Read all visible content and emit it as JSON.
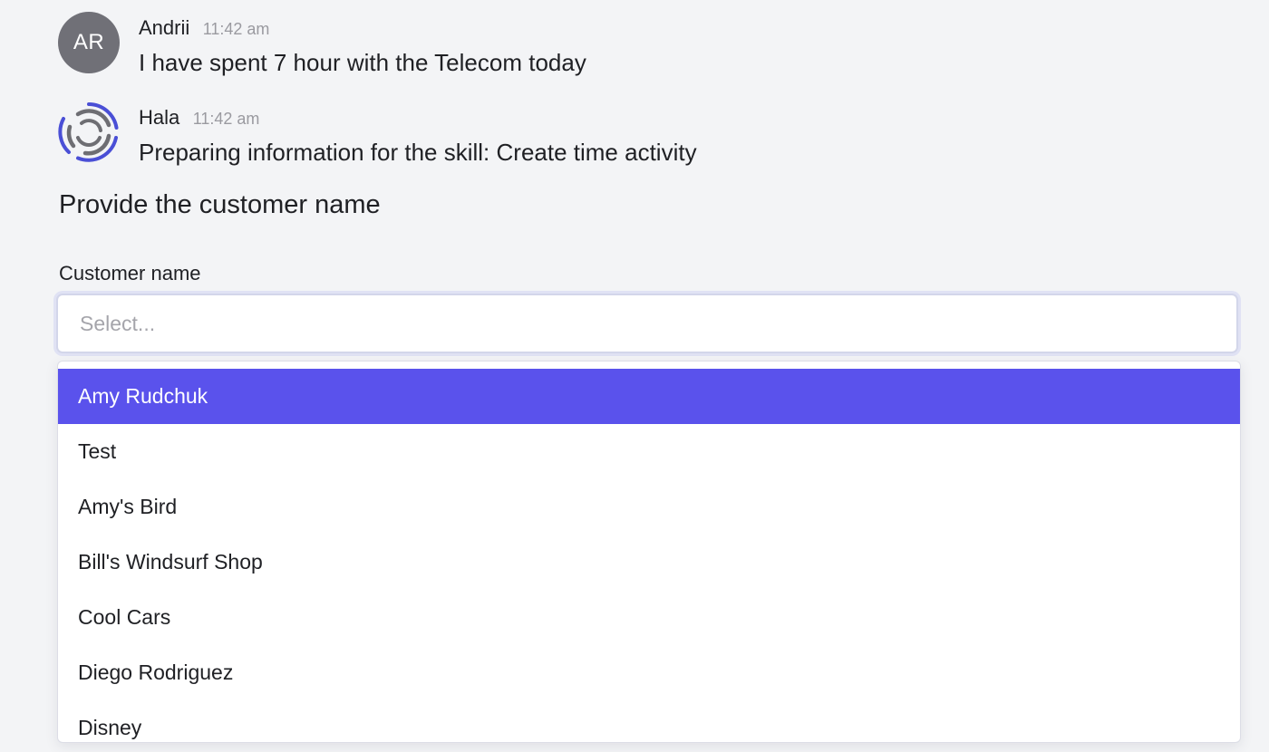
{
  "messages": [
    {
      "author": "Andrii",
      "time": "11:42 am",
      "avatar_initials": "AR",
      "avatar_color": "#707077",
      "text": "I have spent 7 hour with the Telecom today"
    },
    {
      "author": "Hala",
      "time": "11:42 am",
      "avatar_icon": "hala-bot-logo-icon",
      "text": "Preparing information for the skill: Create time activity"
    }
  ],
  "form": {
    "title": "Provide the customer name",
    "customer_field": {
      "label": "Customer name",
      "placeholder": "Select...",
      "options": [
        "Amy Rudchuk",
        "Test",
        "Amy's Bird",
        "Bill's Windsurf Shop",
        "Cool Cars",
        "Diego Rodriguez",
        "Disney"
      ],
      "highlighted_option": "Amy Rudchuk"
    }
  },
  "colors": {
    "accent": "#5a52ec",
    "avatar_gray": "#707077",
    "bot_logo_blue": "#4a4fd6",
    "bot_logo_gray": "#6e6e73"
  }
}
